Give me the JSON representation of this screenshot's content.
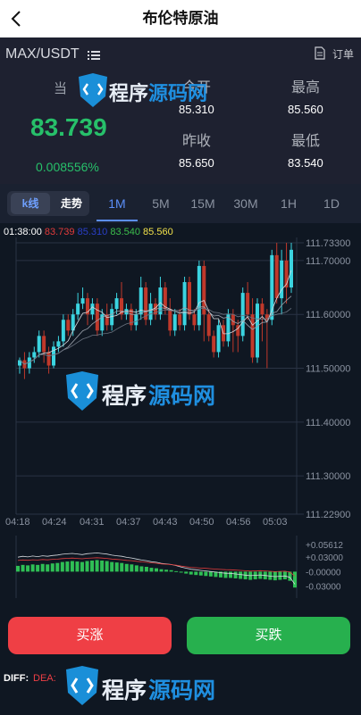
{
  "header": {
    "title": "布伦特原油",
    "back_icon": "chevron-left-icon"
  },
  "quote": {
    "pair": "MAX/USDT",
    "order_label": "订单",
    "current_label": "当",
    "price": "83.739",
    "change_pct": "0.008556%",
    "open_label": "今开",
    "open_value": "85.310",
    "high_label": "最高",
    "high_value": "85.560",
    "prev_close_label": "昨收",
    "prev_close_value": "85.650",
    "low_label": "最低",
    "low_value": "83.540",
    "up_color": "#27c06a"
  },
  "tabs": {
    "kline": "k线",
    "trend": "走势",
    "intervals": [
      "1M",
      "5M",
      "15M",
      "30M",
      "1H",
      "1D"
    ],
    "active_interval": "1M"
  },
  "ohlc_bar": {
    "time": "01:38:00",
    "v1": "83.739",
    "v2": "85.310",
    "v3": "83.540",
    "v4": "85.560"
  },
  "chart_data": {
    "type": "candlestick",
    "y_ticks": [
      "111.73300",
      "111.70000",
      "111.60000",
      "111.50000",
      "111.40000",
      "111.30000",
      "111.22900"
    ],
    "ylim": [
      111.229,
      111.733
    ],
    "x_ticks": [
      "04:18",
      "04:24",
      "04:31",
      "04:37",
      "04:43",
      "04:50",
      "04:56",
      "05:03"
    ],
    "up_color": "#3bd4e0",
    "down_color": "#c0392b",
    "candles": [
      {
        "o": 111.505,
        "c": 111.515,
        "h": 111.52,
        "l": 111.49
      },
      {
        "o": 111.515,
        "c": 111.5,
        "h": 111.53,
        "l": 111.48
      },
      {
        "o": 111.5,
        "c": 111.52,
        "h": 111.53,
        "l": 111.49
      },
      {
        "o": 111.52,
        "c": 111.53,
        "h": 111.54,
        "l": 111.51
      },
      {
        "o": 111.53,
        "c": 111.56,
        "h": 111.57,
        "l": 111.52
      },
      {
        "o": 111.56,
        "c": 111.53,
        "h": 111.57,
        "l": 111.51
      },
      {
        "o": 111.53,
        "c": 111.505,
        "h": 111.54,
        "l": 111.49
      },
      {
        "o": 111.505,
        "c": 111.54,
        "h": 111.55,
        "l": 111.5
      },
      {
        "o": 111.54,
        "c": 111.55,
        "h": 111.56,
        "l": 111.53
      },
      {
        "o": 111.55,
        "c": 111.59,
        "h": 111.6,
        "l": 111.54
      },
      {
        "o": 111.59,
        "c": 111.57,
        "h": 111.6,
        "l": 111.56
      },
      {
        "o": 111.57,
        "c": 111.6,
        "h": 111.61,
        "l": 111.56
      },
      {
        "o": 111.6,
        "c": 111.62,
        "h": 111.64,
        "l": 111.59
      },
      {
        "o": 111.62,
        "c": 111.63,
        "h": 111.65,
        "l": 111.61
      },
      {
        "o": 111.63,
        "c": 111.6,
        "h": 111.64,
        "l": 111.58
      },
      {
        "o": 111.6,
        "c": 111.62,
        "h": 111.63,
        "l": 111.59
      },
      {
        "o": 111.62,
        "c": 111.57,
        "h": 111.63,
        "l": 111.56
      },
      {
        "o": 111.57,
        "c": 111.6,
        "h": 111.61,
        "l": 111.56
      },
      {
        "o": 111.6,
        "c": 111.58,
        "h": 111.62,
        "l": 111.57
      },
      {
        "o": 111.58,
        "c": 111.61,
        "h": 111.62,
        "l": 111.57
      },
      {
        "o": 111.61,
        "c": 111.63,
        "h": 111.64,
        "l": 111.6
      },
      {
        "o": 111.63,
        "c": 111.6,
        "h": 111.66,
        "l": 111.59
      },
      {
        "o": 111.6,
        "c": 111.61,
        "h": 111.62,
        "l": 111.59
      },
      {
        "o": 111.61,
        "c": 111.58,
        "h": 111.62,
        "l": 111.57
      },
      {
        "o": 111.58,
        "c": 111.6,
        "h": 111.61,
        "l": 111.57
      },
      {
        "o": 111.6,
        "c": 111.65,
        "h": 111.67,
        "l": 111.59
      },
      {
        "o": 111.65,
        "c": 111.59,
        "h": 111.66,
        "l": 111.58
      },
      {
        "o": 111.59,
        "c": 111.62,
        "h": 111.64,
        "l": 111.58
      },
      {
        "o": 111.62,
        "c": 111.6,
        "h": 111.63,
        "l": 111.59
      },
      {
        "o": 111.6,
        "c": 111.65,
        "h": 111.67,
        "l": 111.59
      },
      {
        "o": 111.65,
        "c": 111.61,
        "h": 111.66,
        "l": 111.6
      },
      {
        "o": 111.61,
        "c": 111.57,
        "h": 111.63,
        "l": 111.56
      },
      {
        "o": 111.57,
        "c": 111.6,
        "h": 111.61,
        "l": 111.56
      },
      {
        "o": 111.6,
        "c": 111.58,
        "h": 111.61,
        "l": 111.57
      },
      {
        "o": 111.58,
        "c": 111.66,
        "h": 111.67,
        "l": 111.57
      },
      {
        "o": 111.66,
        "c": 111.6,
        "h": 111.67,
        "l": 111.59
      },
      {
        "o": 111.6,
        "c": 111.58,
        "h": 111.61,
        "l": 111.57
      },
      {
        "o": 111.58,
        "c": 111.69,
        "h": 111.7,
        "l": 111.57
      },
      {
        "o": 111.69,
        "c": 111.6,
        "h": 111.7,
        "l": 111.55
      },
      {
        "o": 111.6,
        "c": 111.56,
        "h": 111.61,
        "l": 111.55
      },
      {
        "o": 111.56,
        "c": 111.53,
        "h": 111.57,
        "l": 111.52
      },
      {
        "o": 111.53,
        "c": 111.58,
        "h": 111.59,
        "l": 111.52
      },
      {
        "o": 111.58,
        "c": 111.55,
        "h": 111.59,
        "l": 111.54
      },
      {
        "o": 111.55,
        "c": 111.6,
        "h": 111.61,
        "l": 111.54
      },
      {
        "o": 111.6,
        "c": 111.58,
        "h": 111.61,
        "l": 111.53
      },
      {
        "o": 111.58,
        "c": 111.56,
        "h": 111.59,
        "l": 111.53
      },
      {
        "o": 111.56,
        "c": 111.64,
        "h": 111.65,
        "l": 111.55
      },
      {
        "o": 111.64,
        "c": 111.6,
        "h": 111.66,
        "l": 111.59
      },
      {
        "o": 111.6,
        "c": 111.52,
        "h": 111.63,
        "l": 111.51
      },
      {
        "o": 111.52,
        "c": 111.62,
        "h": 111.63,
        "l": 111.51
      },
      {
        "o": 111.62,
        "c": 111.6,
        "h": 111.63,
        "l": 111.55
      },
      {
        "o": 111.6,
        "c": 111.59,
        "h": 111.61,
        "l": 111.5
      },
      {
        "o": 111.59,
        "c": 111.71,
        "h": 111.72,
        "l": 111.58
      },
      {
        "o": 111.71,
        "c": 111.63,
        "h": 111.733,
        "l": 111.62
      },
      {
        "o": 111.63,
        "c": 111.7,
        "h": 111.72,
        "l": 111.6
      },
      {
        "o": 111.7,
        "c": 111.65,
        "h": 111.733,
        "l": 111.62
      },
      {
        "o": 111.65,
        "c": 111.72,
        "h": 111.733,
        "l": 111.64
      }
    ]
  },
  "macd": {
    "ticks": [
      "+0.05612",
      "+0.03000",
      "-0.00000",
      "-0.03000"
    ],
    "ylim": [
      -0.04,
      0.06
    ],
    "bars": [
      0.012,
      0.014,
      0.013,
      0.015,
      0.014,
      0.016,
      0.015,
      0.017,
      0.018,
      0.02,
      0.021,
      0.022,
      0.021,
      0.02,
      0.022,
      0.023,
      0.024,
      0.023,
      0.022,
      0.02,
      0.019,
      0.018,
      0.016,
      0.015,
      0.013,
      0.011,
      0.01,
      0.008,
      0.007,
      0.005,
      0.004,
      0.003,
      0.001,
      -0.002,
      -0.004,
      -0.006,
      -0.007,
      -0.008,
      -0.009,
      -0.01,
      -0.011,
      -0.012,
      -0.013,
      -0.013,
      -0.014,
      -0.015,
      -0.016,
      -0.017,
      -0.016,
      -0.015,
      -0.016,
      -0.017,
      -0.018,
      -0.017,
      -0.016,
      -0.019,
      -0.033
    ]
  },
  "actions": {
    "buy_up": "买涨",
    "buy_down": "买跌"
  },
  "footer": {
    "diff_label": "DIFF:",
    "dea_label": "DEA:"
  },
  "watermark": {
    "text_cn_a": "程序",
    "text_cn_b": "源码网",
    "logo_icon": "shield-logo-icon"
  }
}
